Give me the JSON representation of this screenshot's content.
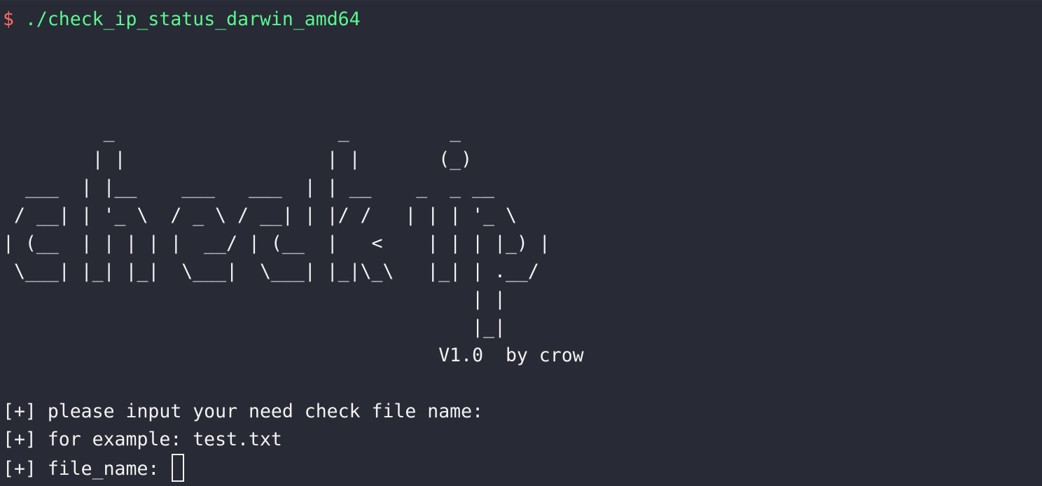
{
  "terminal": {
    "prompt_symbol": "$",
    "command": "./check_ip_status_darwin_amd64",
    "banner": "         _                    _         _\n        | |                  | |       (_)\n  ___  | |__    ___   ___  | | __    _  _ __\n / __| | '_ \\  / _ \\ / __| | |/ /   | | | '_ \\\n| (__  | | | | |  __/ | (__  |   <    | | | |_) |\n \\___| |_| |_|  \\___|  \\___| |_|\\_\\   |_| | .__/\n                                          | |\n                                          |_|\n                                       V1.0  by crow",
    "output": [
      "[+] please input your need check file name:",
      "[+] for example: test.txt",
      "[+] file_name: "
    ],
    "colors": {
      "background": "#282a36",
      "prompt": "#ff6e67",
      "command": "#5af78e",
      "text": "#f2f2f2"
    }
  }
}
